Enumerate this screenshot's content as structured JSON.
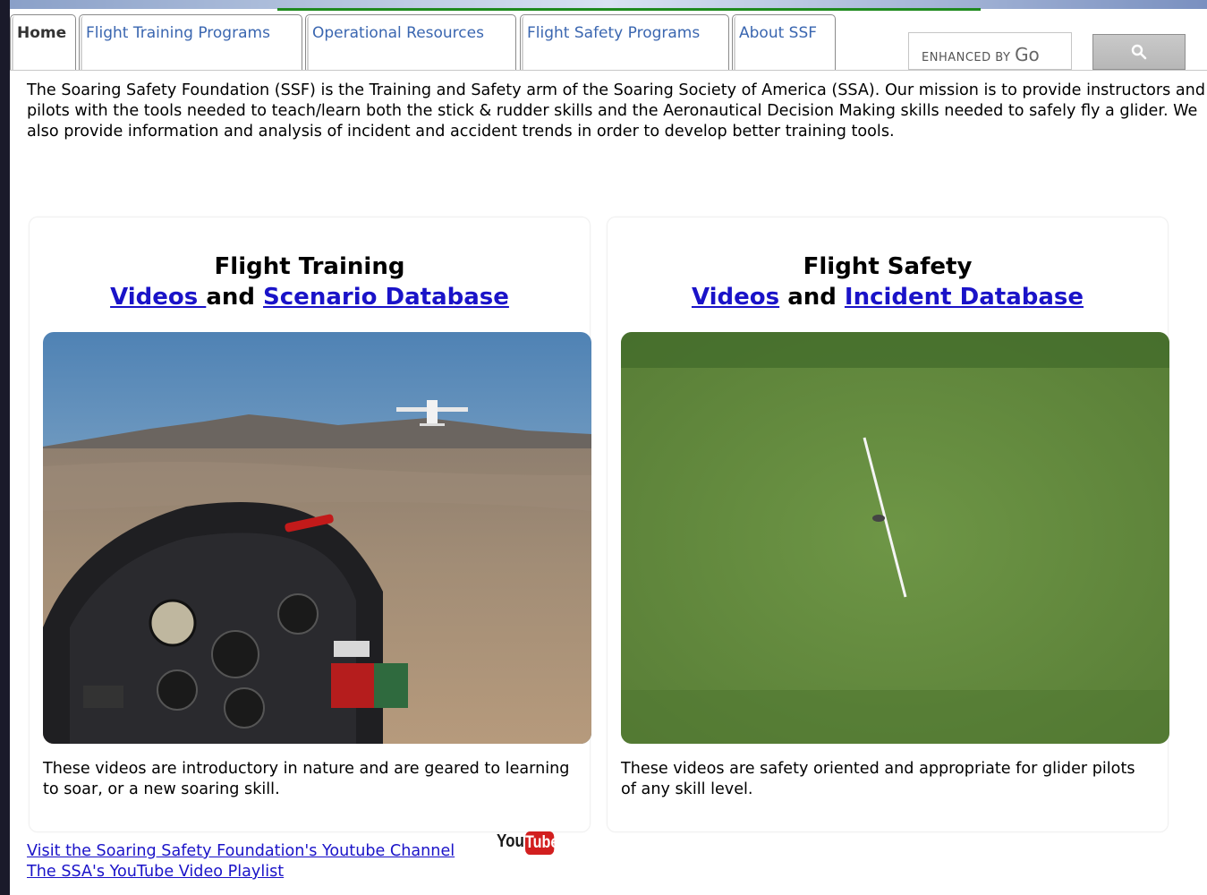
{
  "tabs": [
    {
      "label": "Home"
    },
    {
      "label": "Flight Training Programs"
    },
    {
      "label": "Operational Resources"
    },
    {
      "label": "Flight Safety Programs"
    },
    {
      "label": "About SSF"
    }
  ],
  "search": {
    "branding_prefix": "ENHANCED BY",
    "branding_go": "Go",
    "button_icon": "search-icon"
  },
  "intro": "The Soaring Safety Foundation (SSF) is the Training and Safety arm of the Soaring Society of America (SSA). Our mission is to provide instructors and pilots with the tools needed to teach/learn both the stick & rudder skills and the Aeronautical Decision Making skills needed to safely fly a glider. We also provide information and analysis of incident and accident trends in order to develop better training tools.",
  "cards": [
    {
      "heading": "Flight Training",
      "link1": "Videos ",
      "and": "and",
      "link2": "Scenario Database",
      "description": "These videos are introductory in nature and are geared to learning to soar, or a new soaring skill."
    },
    {
      "heading": "Flight Safety",
      "link1": "Videos",
      "and": "and",
      "link2": "Incident Database",
      "description": "These videos are safety oriented and appropriate for glider pilots of any skill level."
    }
  ],
  "links": {
    "youtube_channel": "Visit the Soaring Safety Foundation's Youtube Channel",
    "playlist": "The SSA's YouTube Video Playlist"
  },
  "youtube_logo": {
    "you": "You",
    "tube": "Tube"
  }
}
